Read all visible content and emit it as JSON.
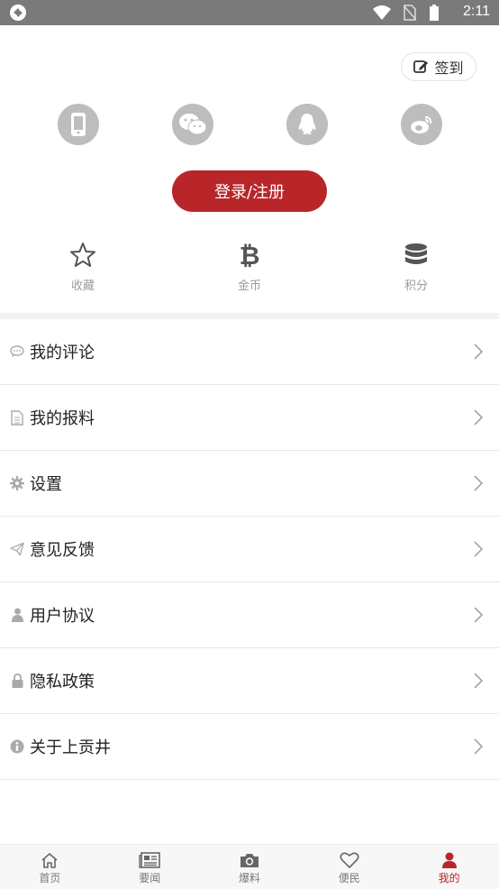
{
  "status_bar": {
    "time": "2:11"
  },
  "header": {
    "signin_label": "签到"
  },
  "social": {
    "icons": [
      "phone-icon",
      "wechat-icon",
      "qq-icon",
      "weibo-icon"
    ]
  },
  "login": {
    "label": "登录/注册"
  },
  "stats": [
    {
      "label": "收藏",
      "icon": "star-icon"
    },
    {
      "label": "金币",
      "icon": "bitcoin-icon"
    },
    {
      "label": "积分",
      "icon": "database-icon"
    }
  ],
  "menu": [
    {
      "label": "我的评论",
      "icon": "comment-icon"
    },
    {
      "label": "我的报料",
      "icon": "document-icon"
    },
    {
      "label": "设置",
      "icon": "gear-icon"
    },
    {
      "label": "意见反馈",
      "icon": "send-icon"
    },
    {
      "label": "用户协议",
      "icon": "user-icon"
    },
    {
      "label": "隐私政策",
      "icon": "lock-icon"
    },
    {
      "label": "关于上贡井",
      "icon": "info-icon"
    }
  ],
  "tabbar": [
    {
      "label": "首页",
      "icon": "home-icon"
    },
    {
      "label": "要闻",
      "icon": "newspaper-icon"
    },
    {
      "label": "爆料",
      "icon": "camera-icon"
    },
    {
      "label": "便民",
      "icon": "heart-icon"
    },
    {
      "label": "我的",
      "icon": "person-icon",
      "active": true
    }
  ],
  "colors": {
    "accent": "#b8262a",
    "status_bar": "#7a7a7a",
    "icon_gray": "#bdbdbd"
  }
}
